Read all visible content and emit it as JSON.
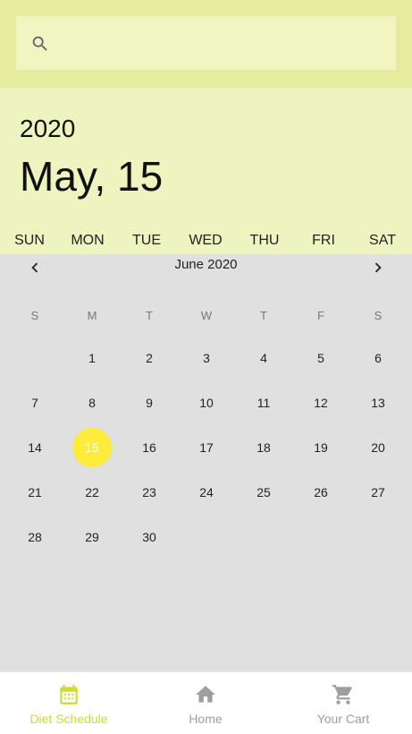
{
  "search": {
    "placeholder": "",
    "value": ""
  },
  "header": {
    "year": "2020",
    "date": "May, 15"
  },
  "week_strip": [
    "SUN",
    "MON",
    "TUE",
    "WED",
    "THU",
    "FRI",
    "SAT"
  ],
  "calendar": {
    "month_title": "June 2020",
    "dow": [
      "S",
      "M",
      "T",
      "W",
      "T",
      "F",
      "S"
    ],
    "weeks": [
      [
        "",
        "1",
        "2",
        "3",
        "4",
        "5",
        "6"
      ],
      [
        "7",
        "8",
        "9",
        "10",
        "11",
        "12",
        "13"
      ],
      [
        "14",
        "15",
        "16",
        "17",
        "18",
        "19",
        "20"
      ],
      [
        "21",
        "22",
        "23",
        "24",
        "25",
        "26",
        "27"
      ],
      [
        "28",
        "29",
        "30",
        "",
        "",
        "",
        ""
      ]
    ],
    "selected": "15",
    "selected_color": "#ffeb3b"
  },
  "bottom_nav": {
    "items": [
      {
        "label": "Diet Schedule",
        "icon": "calendar-icon",
        "active": true
      },
      {
        "label": "Home",
        "icon": "home-icon",
        "active": false
      },
      {
        "label": "Your Cart",
        "icon": "cart-icon",
        "active": false
      }
    ],
    "active_color": "#cddc39",
    "inactive_color": "#9e9e9e"
  },
  "colors": {
    "topbar": "#e6ec9e",
    "search_bg": "#f0f5c1",
    "header_bg": "#eef4c0",
    "calendar_bg": "#e0e0e0"
  }
}
